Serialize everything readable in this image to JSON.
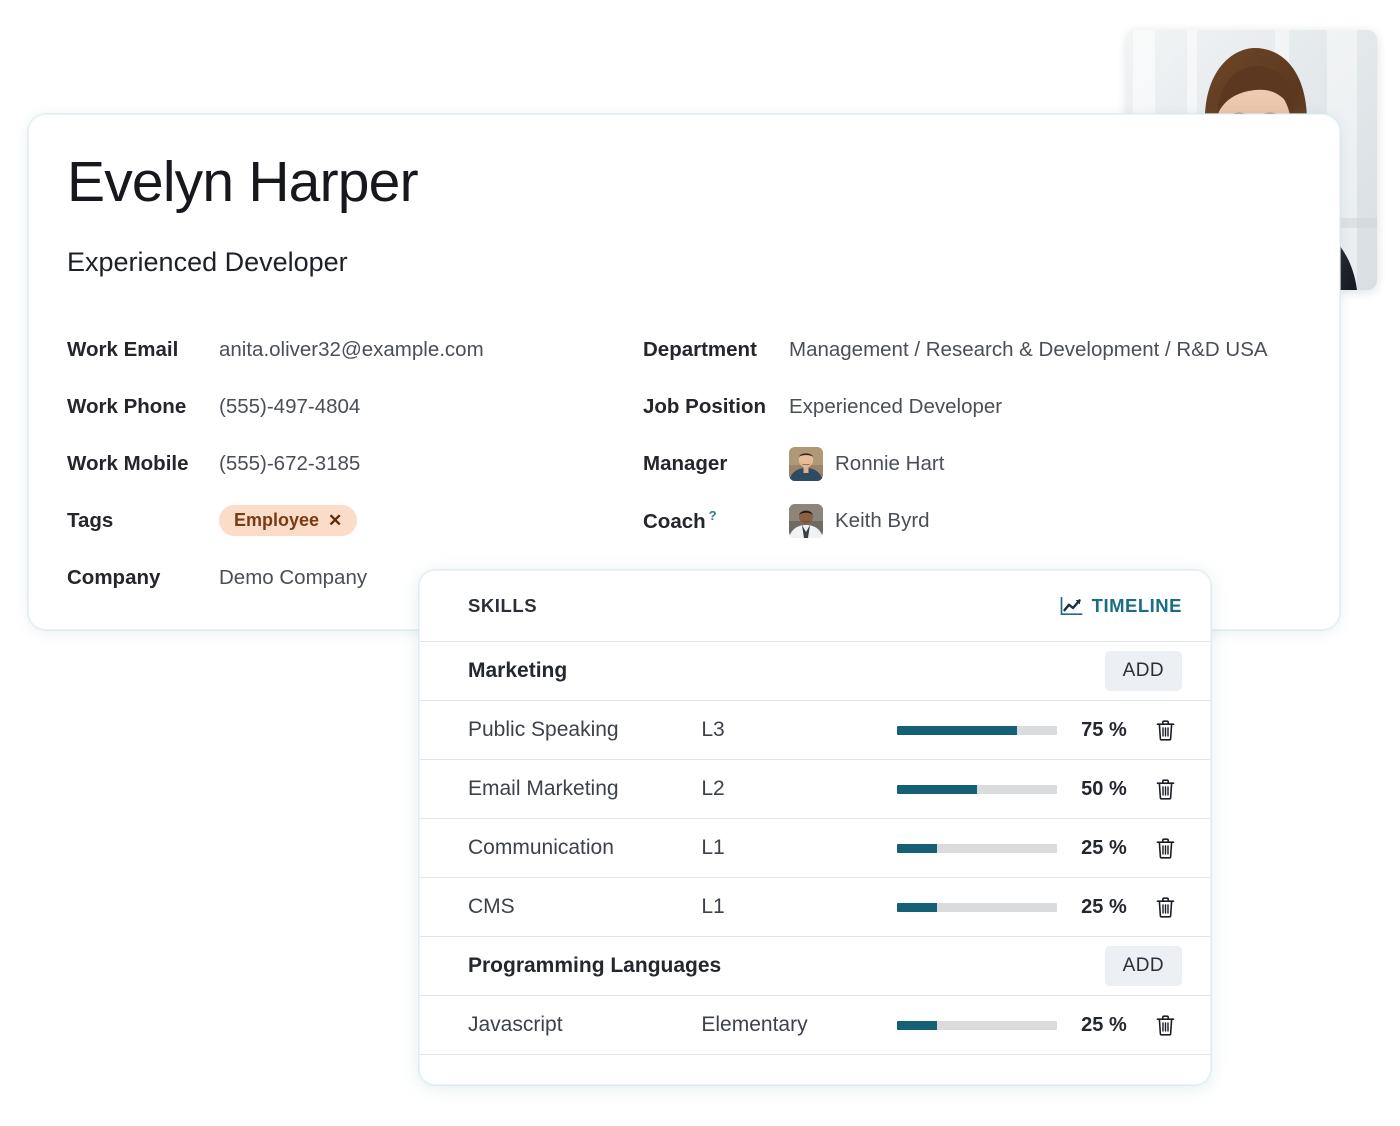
{
  "employee": {
    "name": "Evelyn Harper",
    "title": "Experienced Developer",
    "photo_alt": "Evelyn Harper portrait",
    "fields_left": [
      {
        "label": "Work Email",
        "value": "anita.oliver32@example.com"
      },
      {
        "label": "Work Phone",
        "value": "(555)-497-4804"
      },
      {
        "label": "Work Mobile",
        "value": "(555)-672-3185"
      },
      {
        "label": "Tags",
        "value": "Employee",
        "chip_close": "✕"
      },
      {
        "label": "Company",
        "value": "Demo Company"
      }
    ],
    "fields_right": [
      {
        "label": "Department",
        "value": "Management / Research & Development / R&D USA"
      },
      {
        "label": "Job Position",
        "value": "Experienced Developer"
      },
      {
        "label": "Manager",
        "value": "Ronnie Hart"
      },
      {
        "label": "Coach",
        "value": "Keith Byrd",
        "help": "?"
      }
    ]
  },
  "skills": {
    "header_title": "SKILLS",
    "timeline_label": "TIMELINE",
    "timeline_icon": "line-chart-icon",
    "add_label": "ADD",
    "delete_icon": "trash-icon",
    "groups": [
      {
        "name": "Marketing",
        "rows": [
          {
            "name": "Public Speaking",
            "level": "L3",
            "percent": 75,
            "percent_label": "75 %"
          },
          {
            "name": "Email Marketing",
            "level": "L2",
            "percent": 50,
            "percent_label": "50 %"
          },
          {
            "name": "Communication",
            "level": "L1",
            "percent": 25,
            "percent_label": "25 %"
          },
          {
            "name": "CMS",
            "level": "L1",
            "percent": 25,
            "percent_label": "25 %"
          }
        ]
      },
      {
        "name": "Programming Languages",
        "rows": [
          {
            "name": "Javascript",
            "level": "Elementary",
            "percent": 25,
            "percent_label": "25 %"
          }
        ]
      }
    ]
  },
  "colors": {
    "progress_fill": "#166076",
    "progress_track": "#d9dbdd",
    "timeline_link": "#1a6d86",
    "tag_background": "#fbdcc8",
    "tag_text": "#7a3b14",
    "add_button_background": "#eceff3",
    "page_background": "#ffffff"
  }
}
